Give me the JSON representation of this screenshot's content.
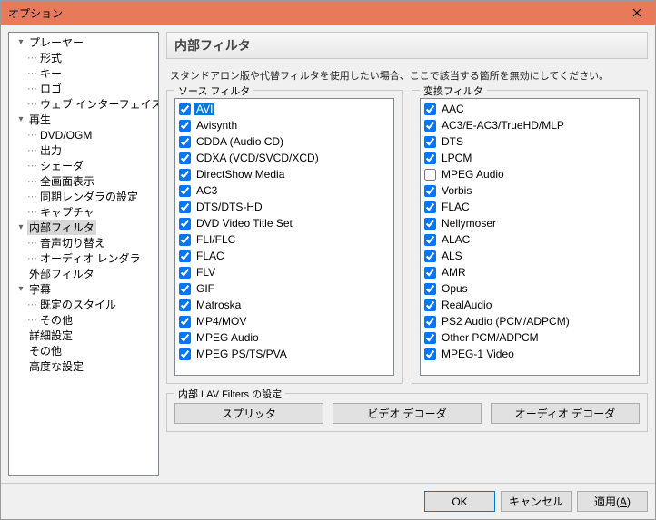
{
  "window": {
    "title": "オプション"
  },
  "tree": [
    {
      "depth": 1,
      "exp": "open",
      "label": "プレーヤー"
    },
    {
      "depth": 2,
      "label": "形式"
    },
    {
      "depth": 2,
      "label": "キー"
    },
    {
      "depth": 2,
      "label": "ロゴ"
    },
    {
      "depth": 2,
      "label": "ウェブ インターフェイス"
    },
    {
      "depth": 1,
      "exp": "open",
      "label": "再生"
    },
    {
      "depth": 2,
      "label": "DVD/OGM"
    },
    {
      "depth": 2,
      "label": "出力"
    },
    {
      "depth": 2,
      "label": "シェーダ"
    },
    {
      "depth": 2,
      "label": "全画面表示"
    },
    {
      "depth": 2,
      "label": "同期レンダラの設定"
    },
    {
      "depth": 2,
      "label": "キャプチャ"
    },
    {
      "depth": 1,
      "exp": "open",
      "label": "内部フィルタ",
      "selected": true
    },
    {
      "depth": 2,
      "label": "音声切り替え"
    },
    {
      "depth": 2,
      "label": "オーディオ レンダラ"
    },
    {
      "depth": 1,
      "label": "外部フィルタ"
    },
    {
      "depth": 1,
      "exp": "open",
      "label": "字幕"
    },
    {
      "depth": 2,
      "label": "既定のスタイル"
    },
    {
      "depth": 2,
      "label": "その他"
    },
    {
      "depth": 1,
      "label": "詳細設定"
    },
    {
      "depth": 1,
      "label": "その他"
    },
    {
      "depth": 1,
      "label": "高度な設定"
    }
  ],
  "page": {
    "title": "内部フィルタ",
    "desc": "スタンドアロン版や代替フィルタを使用したい場合、ここで該当する箇所を無効にしてください。",
    "source_legend": "ソース フィルタ",
    "transform_legend": "変換フィルタ",
    "lav_legend": "内部 LAV Filters の設定",
    "lav_buttons": {
      "splitter": "スプリッタ",
      "video": "ビデオ デコーダ",
      "audio": "オーディオ デコーダ"
    }
  },
  "source_filters": [
    {
      "label": "AVI",
      "checked": true,
      "selected": true
    },
    {
      "label": "Avisynth",
      "checked": true
    },
    {
      "label": "CDDA (Audio CD)",
      "checked": true
    },
    {
      "label": "CDXA (VCD/SVCD/XCD)",
      "checked": true
    },
    {
      "label": "DirectShow Media",
      "checked": true
    },
    {
      "label": "AC3",
      "checked": true
    },
    {
      "label": "DTS/DTS-HD",
      "checked": true
    },
    {
      "label": "DVD Video Title Set",
      "checked": true
    },
    {
      "label": "FLI/FLC",
      "checked": true
    },
    {
      "label": "FLAC",
      "checked": true
    },
    {
      "label": "FLV",
      "checked": true
    },
    {
      "label": "GIF",
      "checked": true
    },
    {
      "label": "Matroska",
      "checked": true
    },
    {
      "label": "MP4/MOV",
      "checked": true
    },
    {
      "label": "MPEG Audio",
      "checked": true
    },
    {
      "label": "MPEG PS/TS/PVA",
      "checked": true
    }
  ],
  "transform_filters": [
    {
      "label": "AAC",
      "checked": true
    },
    {
      "label": "AC3/E-AC3/TrueHD/MLP",
      "checked": true
    },
    {
      "label": "DTS",
      "checked": true
    },
    {
      "label": "LPCM",
      "checked": true
    },
    {
      "label": "MPEG Audio",
      "checked": false
    },
    {
      "label": "Vorbis",
      "checked": true
    },
    {
      "label": "FLAC",
      "checked": true
    },
    {
      "label": "Nellymoser",
      "checked": true
    },
    {
      "label": "ALAC",
      "checked": true
    },
    {
      "label": "ALS",
      "checked": true
    },
    {
      "label": "AMR",
      "checked": true
    },
    {
      "label": "Opus",
      "checked": true
    },
    {
      "label": "RealAudio",
      "checked": true
    },
    {
      "label": "PS2 Audio (PCM/ADPCM)",
      "checked": true
    },
    {
      "label": "Other PCM/ADPCM",
      "checked": true
    },
    {
      "label": "MPEG-1 Video",
      "checked": true
    }
  ],
  "footer": {
    "ok": "OK",
    "cancel": "キャンセル",
    "apply": "適用(A)"
  }
}
